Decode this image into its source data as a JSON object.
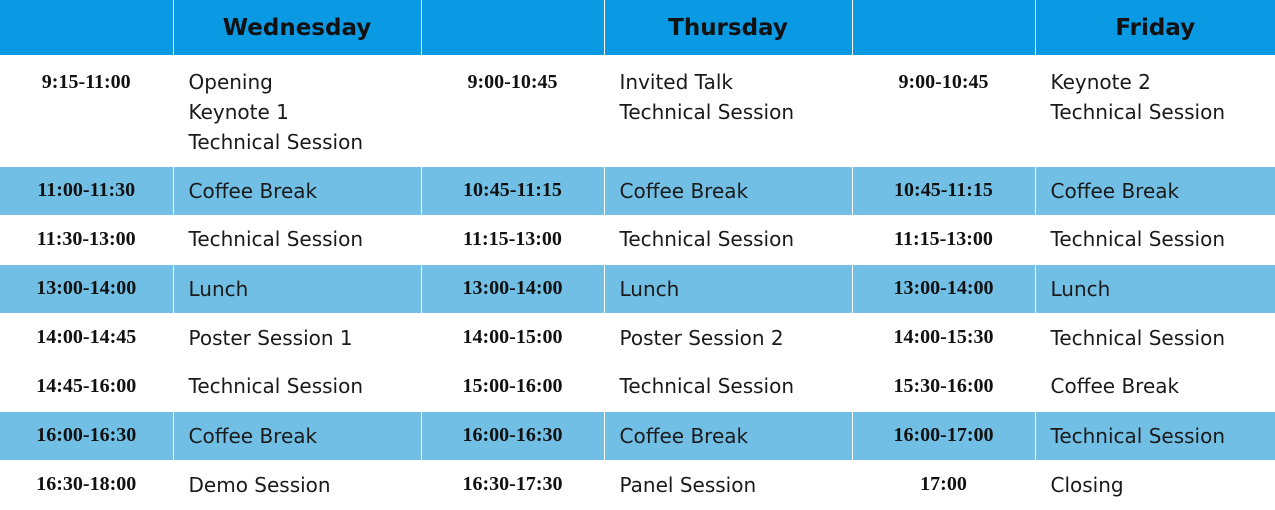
{
  "headers": [
    "",
    "Wednesday",
    "",
    "Thursday",
    "",
    "Friday"
  ],
  "rows": [
    {
      "highlight": false,
      "cells": [
        {
          "time": "9:15-11:00",
          "lines": [
            "Opening",
            "Keynote 1",
            "Technical Session"
          ]
        },
        {
          "time": "9:00-10:45",
          "lines": [
            "Invited Talk",
            "Technical Session"
          ]
        },
        {
          "time": "9:00-10:45",
          "lines": [
            "Keynote 2",
            " Technical Session"
          ]
        }
      ]
    },
    {
      "highlight": true,
      "cells": [
        {
          "time": "11:00-11:30",
          "lines": [
            "Coffee Break"
          ]
        },
        {
          "time": "10:45-11:15",
          "lines": [
            "Coffee Break"
          ]
        },
        {
          "time": "10:45-11:15",
          "lines": [
            "Coffee Break"
          ]
        }
      ]
    },
    {
      "highlight": false,
      "cells": [
        {
          "time": "11:30-13:00",
          "lines": [
            "Technical Session"
          ]
        },
        {
          "time": "11:15-13:00",
          "lines": [
            "Technical Session"
          ]
        },
        {
          "time": "11:15-13:00",
          "lines": [
            "Technical Session"
          ]
        }
      ]
    },
    {
      "highlight": true,
      "cells": [
        {
          "time": "13:00-14:00",
          "lines": [
            "Lunch"
          ]
        },
        {
          "time": "13:00-14:00",
          "lines": [
            "Lunch"
          ]
        },
        {
          "time": "13:00-14:00",
          "lines": [
            "Lunch"
          ]
        }
      ]
    },
    {
      "highlight": false,
      "cells": [
        {
          "time": "14:00-14:45",
          "lines": [
            "Poster Session 1"
          ]
        },
        {
          "time": "14:00-15:00",
          "lines": [
            "Poster Session 2"
          ]
        },
        {
          "time": "14:00-15:30",
          "lines": [
            "Technical Session"
          ]
        }
      ]
    },
    {
      "highlight": false,
      "cells": [
        {
          "time": "14:45-16:00",
          "lines": [
            "Technical Session"
          ]
        },
        {
          "time": "15:00-16:00",
          "lines": [
            "Technical Session"
          ]
        },
        {
          "time": "15:30-16:00",
          "lines": [
            "Coffee Break"
          ]
        }
      ]
    },
    {
      "highlight": true,
      "cells": [
        {
          "time": "16:00-16:30",
          "lines": [
            "Coffee Break"
          ]
        },
        {
          "time": "16:00-16:30",
          "lines": [
            "Coffee Break"
          ]
        },
        {
          "time": "16:00-17:00",
          "lines": [
            "Technical Session"
          ]
        }
      ]
    },
    {
      "highlight": false,
      "cells": [
        {
          "time": "16:30-18:00",
          "lines": [
            "Demo Session"
          ]
        },
        {
          "time": "16:30-17:30",
          "lines": [
            "Panel Session"
          ]
        },
        {
          "time": "17:00",
          "lines": [
            "Closing"
          ]
        }
      ]
    }
  ],
  "colors": {
    "header_bg": "#0a9ae4",
    "highlight_bg": "#72bfe6",
    "text": "#111111"
  }
}
